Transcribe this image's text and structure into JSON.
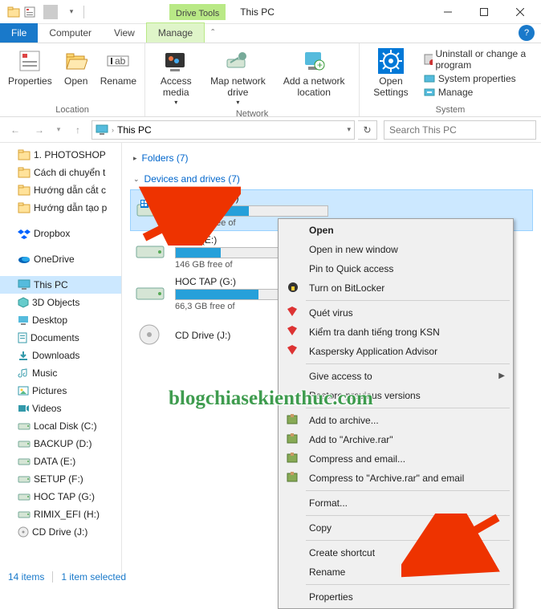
{
  "window": {
    "title": "This PC",
    "drive_tools": "Drive Tools"
  },
  "tabs": {
    "file": "File",
    "computer": "Computer",
    "view": "View",
    "manage": "Manage"
  },
  "ribbon": {
    "location": {
      "label": "Location",
      "properties": "Properties",
      "open": "Open",
      "rename": "Rename"
    },
    "network": {
      "label": "Network",
      "access": "Access media",
      "map": "Map network drive",
      "add": "Add a network location"
    },
    "system": {
      "label": "System",
      "open_settings": "Open Settings",
      "uninstall": "Uninstall or change a program",
      "sysprops": "System properties",
      "manage": "Manage"
    }
  },
  "address": {
    "path": "This PC",
    "search_placeholder": "Search This PC"
  },
  "tree": {
    "items": [
      {
        "label": "1. PHOTOSHOP",
        "icon": "folder"
      },
      {
        "label": "Cách di chuyển t",
        "icon": "folder"
      },
      {
        "label": "Hướng dẫn cắt c",
        "icon": "folder"
      },
      {
        "label": "Hướng dẫn tạo p",
        "icon": "folder"
      },
      {
        "label": "",
        "spacer": true
      },
      {
        "label": "Dropbox",
        "icon": "dropbox"
      },
      {
        "label": "",
        "spacer": true
      },
      {
        "label": "OneDrive",
        "icon": "onedrive"
      },
      {
        "label": "",
        "spacer": true
      },
      {
        "label": "This PC",
        "icon": "pc",
        "selected": true
      },
      {
        "label": "3D Objects",
        "icon": "3d"
      },
      {
        "label": "Desktop",
        "icon": "desktop"
      },
      {
        "label": "Documents",
        "icon": "docs"
      },
      {
        "label": "Downloads",
        "icon": "downloads"
      },
      {
        "label": "Music",
        "icon": "music"
      },
      {
        "label": "Pictures",
        "icon": "pictures"
      },
      {
        "label": "Videos",
        "icon": "videos"
      },
      {
        "label": "Local Disk (C:)",
        "icon": "disk"
      },
      {
        "label": "BACKUP (D:)",
        "icon": "disk"
      },
      {
        "label": "DATA (E:)",
        "icon": "disk"
      },
      {
        "label": "SETUP (F:)",
        "icon": "disk"
      },
      {
        "label": "HOC TAP (G:)",
        "icon": "disk"
      },
      {
        "label": "RIMIX_EFI (H:)",
        "icon": "disk"
      },
      {
        "label": "CD Drive (J:)",
        "icon": "cd"
      }
    ]
  },
  "content": {
    "folders": "Folders (7)",
    "devices": "Devices and drives (7)",
    "drives": [
      {
        "name": "Local Disk (C:)",
        "free": "60,9 GB free of",
        "fill": 48,
        "selected": true
      },
      {
        "name": "DATA (E:)",
        "free": "146 GB free of",
        "fill": 30
      },
      {
        "name": "HOC TAP (G:)",
        "free": "66,3 GB free of",
        "fill": 55
      },
      {
        "name": "CD Drive (J:)",
        "free": "",
        "fill": 0,
        "cd": true
      }
    ],
    "backup": {
      "name": "BACKUP (D:)"
    }
  },
  "context": {
    "open": "Open",
    "newwin": "Open in new window",
    "pin": "Pin to Quick access",
    "bitlocker": "Turn on BitLocker",
    "scan": "Quét virus",
    "ksn": "Kiểm tra danh tiếng trong KSN",
    "kav": "Kaspersky Application Advisor",
    "give": "Give access to",
    "prev": "Restore previous versions",
    "addarc": "Add to archive...",
    "addrar": "Add to \"Archive.rar\"",
    "compemail": "Compress and email...",
    "comprar": "Compress to \"Archive.rar\" and email",
    "format": "Format...",
    "copy": "Copy",
    "shortcut": "Create shortcut",
    "rename": "Rename",
    "props": "Properties"
  },
  "status": {
    "items": "14 items",
    "selected": "1 item selected"
  },
  "watermark": "blogchiasekienthuc.com"
}
